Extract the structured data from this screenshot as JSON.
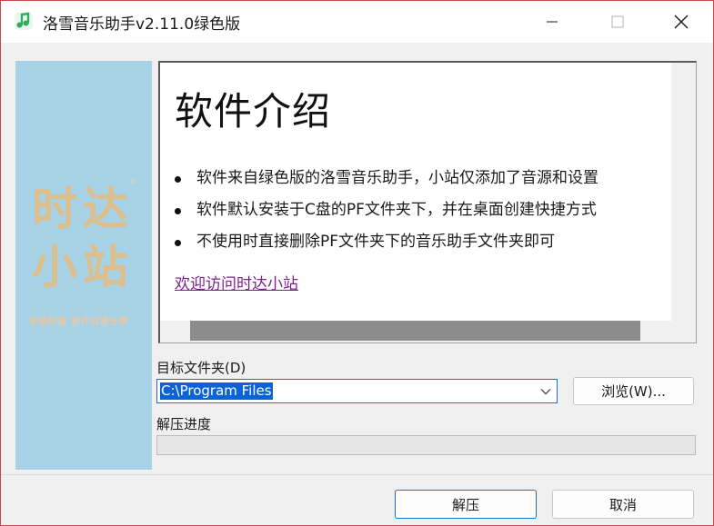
{
  "window": {
    "title": "洛雪音乐助手v2.11.0绿色版",
    "controls": [
      "minimize-icon",
      "maximize-icon",
      "close-icon"
    ]
  },
  "banner": {
    "logo_chars": [
      "时",
      "达",
      "小",
      "站"
    ],
    "tagline_part1": "系统封装",
    "tagline_part2": "软件资源分享",
    "reg_mark": "®"
  },
  "intro": {
    "heading": "软件介绍",
    "items": [
      "软件来自绿色版的洛雪音乐助手，小站仅添加了音源和设置",
      "软件默认安装于C盘的PF文件夹下，并在桌面创建快捷方式",
      "不使用时直接删除PF文件夹下的音乐助手文件夹即可"
    ],
    "link_text": "欢迎访问时达小站"
  },
  "form": {
    "target_label": "目标文件夹(D)",
    "target_value": "C:\\Program Files",
    "browse_label": "浏览(W)...",
    "progress_label": "解压进度",
    "progress_value": 0
  },
  "footer": {
    "extract_label": "解压",
    "cancel_label": "取消"
  },
  "colors": {
    "banner_bg": "#a8d3e6",
    "accent": "#1e6fd0",
    "link": "#7f1f8f",
    "selection": "#0a64d8"
  }
}
